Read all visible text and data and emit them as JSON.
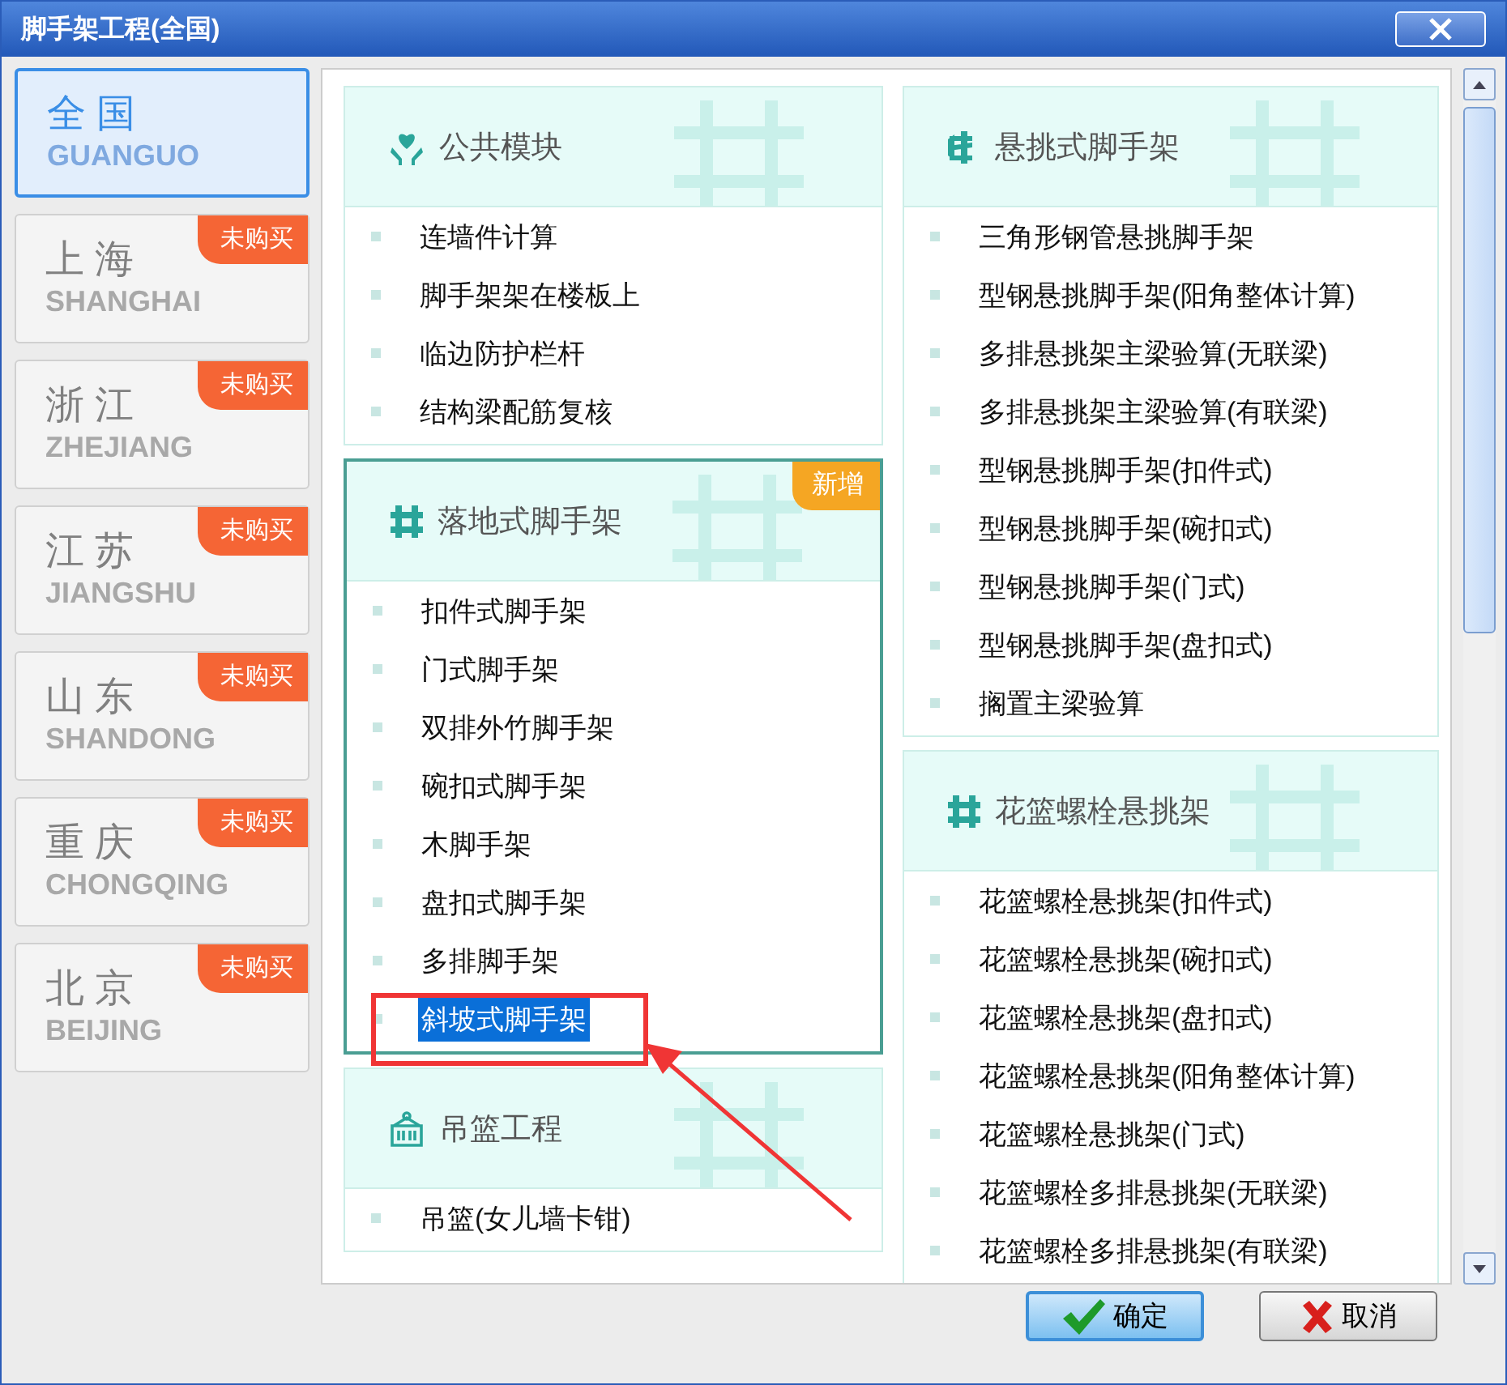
{
  "window": {
    "title": "脚手架工程(全国)"
  },
  "sidebar": {
    "items": [
      {
        "name": "全 国",
        "pinyin": "GUANGUO",
        "selected": true
      },
      {
        "name": "上 海",
        "pinyin": "SHANGHAI",
        "selected": false,
        "badge": "未购买"
      },
      {
        "name": "浙 江",
        "pinyin": "ZHEJIANG",
        "selected": false,
        "badge": "未购买"
      },
      {
        "name": "江 苏",
        "pinyin": "JIANGSHU",
        "selected": false,
        "badge": "未购买"
      },
      {
        "name": "山 东",
        "pinyin": "SHANDONG",
        "selected": false,
        "badge": "未购买"
      },
      {
        "name": "重 庆",
        "pinyin": "CHONGQING",
        "selected": false,
        "badge": "未购买"
      },
      {
        "name": "北 京",
        "pinyin": "BEIJING",
        "selected": false,
        "badge": "未购买"
      }
    ]
  },
  "columns": [
    [
      {
        "title": "公共模块",
        "kind": "heart",
        "active": false,
        "items": [
          {
            "label": "连墙件计算",
            "selected": false
          },
          {
            "label": "脚手架架在楼板上",
            "selected": false
          },
          {
            "label": "临边防护栏杆",
            "selected": false
          },
          {
            "label": "结构梁配筋复核",
            "selected": false
          }
        ]
      },
      {
        "title": "落地式脚手架",
        "kind": "frame",
        "active": true,
        "badge": "新增",
        "items": [
          {
            "label": "扣件式脚手架",
            "selected": false
          },
          {
            "label": "门式脚手架",
            "selected": false
          },
          {
            "label": "双排外竹脚手架",
            "selected": false
          },
          {
            "label": "碗扣式脚手架",
            "selected": false
          },
          {
            "label": "木脚手架",
            "selected": false
          },
          {
            "label": "盘扣式脚手架",
            "selected": false
          },
          {
            "label": "多排脚手架",
            "selected": false
          },
          {
            "label": "斜坡式脚手架",
            "selected": true
          }
        ]
      },
      {
        "title": "吊篮工程",
        "kind": "basket",
        "active": false,
        "items": [
          {
            "label": "吊篮(女儿墙卡钳)",
            "selected": false
          }
        ]
      }
    ],
    [
      {
        "title": "悬挑式脚手架",
        "kind": "tower",
        "active": false,
        "items": [
          {
            "label": "三角形钢管悬挑脚手架",
            "selected": false
          },
          {
            "label": "型钢悬挑脚手架(阳角整体计算)",
            "selected": false
          },
          {
            "label": "多排悬挑架主梁验算(无联梁)",
            "selected": false
          },
          {
            "label": "多排悬挑架主梁验算(有联梁)",
            "selected": false
          },
          {
            "label": "型钢悬挑脚手架(扣件式)",
            "selected": false
          },
          {
            "label": "型钢悬挑脚手架(碗扣式)",
            "selected": false
          },
          {
            "label": "型钢悬挑脚手架(门式)",
            "selected": false
          },
          {
            "label": "型钢悬挑脚手架(盘扣式)",
            "selected": false
          },
          {
            "label": "搁置主梁验算",
            "selected": false
          }
        ]
      },
      {
        "title": "花篮螺栓悬挑架",
        "kind": "frame",
        "active": false,
        "items": [
          {
            "label": "花篮螺栓悬挑架(扣件式)",
            "selected": false
          },
          {
            "label": "花篮螺栓悬挑架(碗扣式)",
            "selected": false
          },
          {
            "label": "花篮螺栓悬挑架(盘扣式)",
            "selected": false
          },
          {
            "label": "花篮螺栓悬挑架(阳角整体计算)",
            "selected": false
          },
          {
            "label": "花篮螺栓悬挑架(门式)",
            "selected": false
          },
          {
            "label": "花篮螺栓多排悬挑架(无联梁)",
            "selected": false
          },
          {
            "label": "花篮螺栓多排悬挑架(有联梁)",
            "selected": false
          }
        ]
      }
    ]
  ],
  "buttons": [
    {
      "label": "确定",
      "kind": "ok"
    },
    {
      "label": "取消",
      "kind": "cancel"
    }
  ]
}
